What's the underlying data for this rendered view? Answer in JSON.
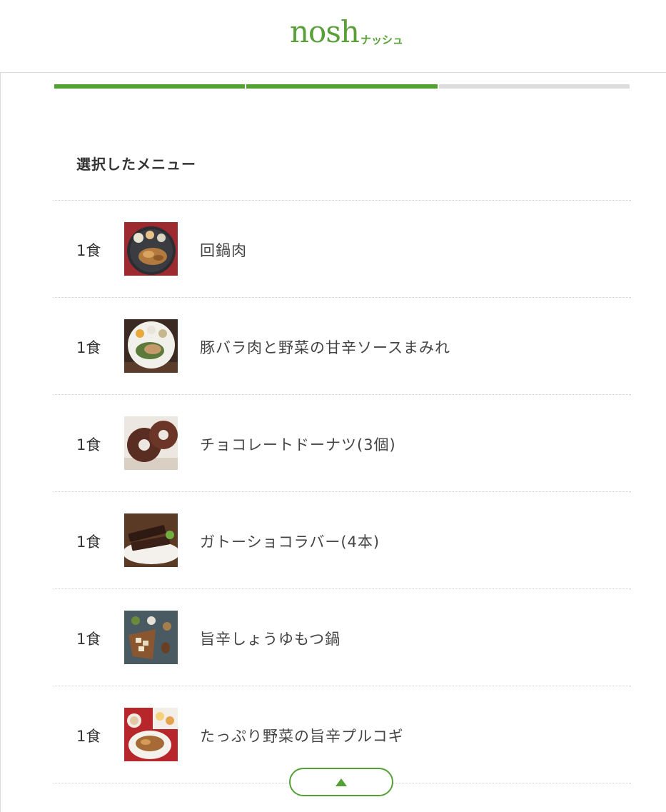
{
  "brand": {
    "logo_main": "nosh",
    "logo_sub": "ナッシュ",
    "accent_color": "#53a134"
  },
  "progress": {
    "total_steps": 3,
    "completed_steps": 2
  },
  "section": {
    "title": "選択したメニュー"
  },
  "menu_items": [
    {
      "qty": "1食",
      "name": "回鍋肉",
      "thumb_icon": "food-photo-hoikoro"
    },
    {
      "qty": "1食",
      "name": "豚バラ肉と野菜の甘辛ソースまみれ",
      "thumb_icon": "food-photo-pork-belly"
    },
    {
      "qty": "1食",
      "name": "チョコレートドーナツ(3個)",
      "thumb_icon": "food-photo-chocolate-donut"
    },
    {
      "qty": "1食",
      "name": "ガトーショコラバー(4本)",
      "thumb_icon": "food-photo-gateau-chocolat"
    },
    {
      "qty": "1食",
      "name": "旨辛しょうゆもつ鍋",
      "thumb_icon": "food-photo-motsunabe"
    },
    {
      "qty": "1食",
      "name": "たっぷり野菜の旨辛プルコギ",
      "thumb_icon": "food-photo-bulgogi"
    }
  ],
  "scroll_top": {
    "icon": "up-triangle-icon"
  }
}
